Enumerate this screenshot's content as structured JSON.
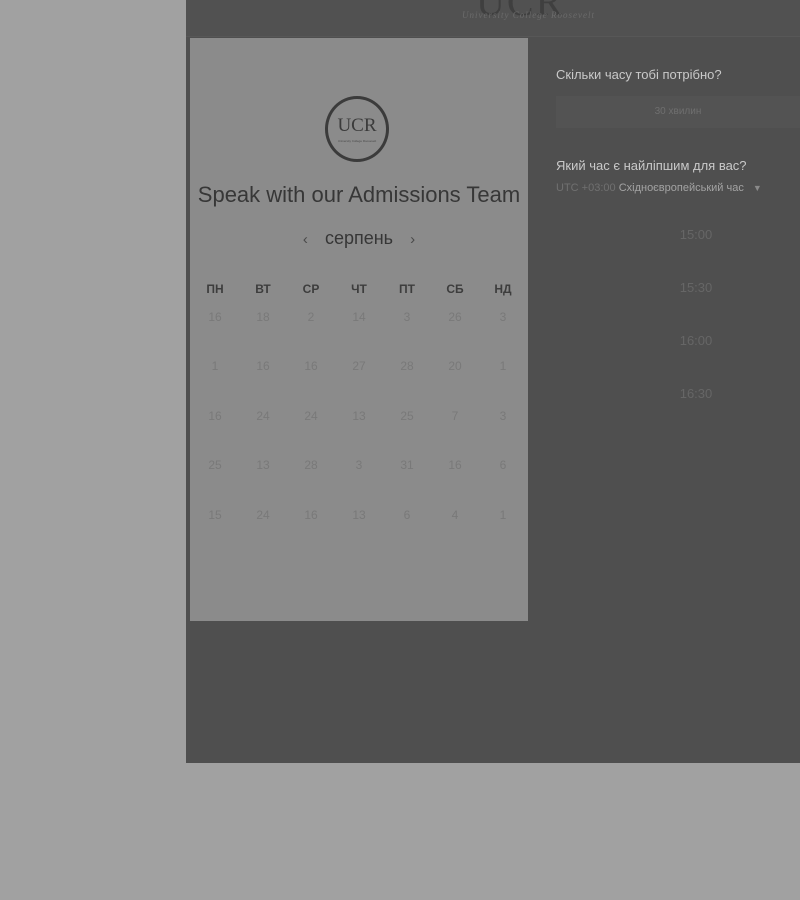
{
  "header": {
    "logo_text": "UCR",
    "logo_subtext": "University College Roosevelt"
  },
  "calendar_card": {
    "logo": {
      "text": "UCR",
      "prefix": "U",
      "subtext": "University College Roosevelt"
    },
    "title": "Speak with our Admissions Team",
    "month": "серпень",
    "prev_icon": "chevron-left-icon",
    "next_icon": "chevron-right-icon",
    "weekdays": [
      "ПН",
      "ВТ",
      "СР",
      "ЧТ",
      "ПТ",
      "СБ",
      "НД"
    ],
    "weeks": [
      [
        "16",
        "18",
        "2",
        "14",
        "3",
        "26",
        "3"
      ],
      [
        "1",
        "16",
        "16",
        "27",
        "28",
        "20",
        "1"
      ],
      [
        "16",
        "24",
        "24",
        "13",
        "25",
        "7",
        "3"
      ],
      [
        "25",
        "13",
        "28",
        "3",
        "31",
        "16",
        "6"
      ],
      [
        "15",
        "24",
        "16",
        "13",
        "6",
        "4",
        "1"
      ]
    ]
  },
  "booking": {
    "duration_question": "Скільки часу тобі потрібно?",
    "duration_value": "30 хвилин",
    "time_question": "Який час є найліпшим для вас?",
    "timezone_offset": "UTC +03:00",
    "timezone_name": "Східноєвропейський час",
    "timezone_caret_icon": "caret-down-icon",
    "time_slots": [
      "15:00",
      "15:30",
      "16:00",
      "16:30"
    ]
  },
  "colors": {
    "page_bg": "#a1a1a1",
    "dark_panel": "#4f4f4f",
    "card_bg": "#8b8b8b"
  }
}
